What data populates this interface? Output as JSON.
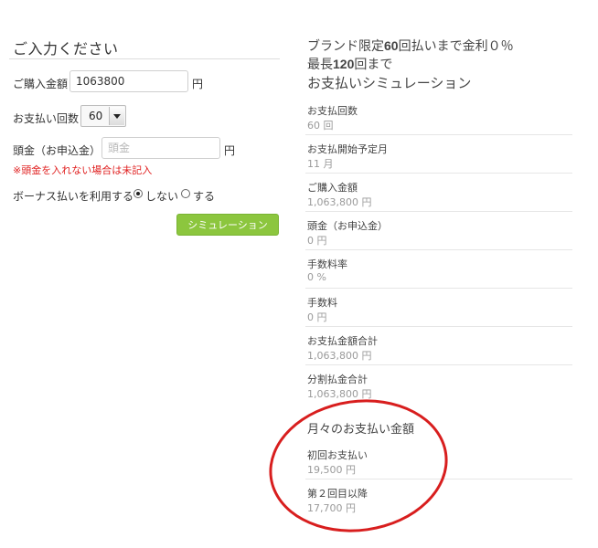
{
  "form": {
    "title": "ご入力ください",
    "purchase_label": "ご購入金額",
    "purchase_value": "1063800",
    "purchase_unit": "円",
    "installments_label": "お支払い回数",
    "installments_value": "60",
    "deposit_label": "頭金（お申込金）",
    "deposit_placeholder": "頭金",
    "deposit_unit": "円",
    "deposit_note": "※頭金を入れない場合は未記入",
    "bonus_label": "ボーナス払いを利用する",
    "bonus_no": "しない",
    "bonus_yes": "する",
    "bonus_selected": "しない",
    "simulate_button": "シミュレーション"
  },
  "result": {
    "heading_line1_pre": "ブランド限定",
    "heading_line1_num": "60",
    "heading_line1_post": "回払いまで金利０％",
    "heading_line2_pre": "最長",
    "heading_line2_num": "120",
    "heading_line2_post": "回まで",
    "heading_line3": "お支払いシミュレーション",
    "rows": [
      {
        "label": "お支払回数",
        "value": "60 回"
      },
      {
        "label": "お支払開始予定月",
        "value": "11 月"
      },
      {
        "label": "ご購入金額",
        "value": "1,063,800 円"
      },
      {
        "label": "頭金（お申込金）",
        "value": "0 円"
      },
      {
        "label": "手数料率",
        "value": "0 %"
      },
      {
        "label": "手数料",
        "value": "0 円"
      },
      {
        "label": "お支払金額合計",
        "value": "1,063,800 円"
      },
      {
        "label": "分割払金合計",
        "value": "1,063,800 円"
      }
    ],
    "monthly_title": "月々のお支払い金額",
    "monthly_rows": [
      {
        "label": "初回お支払い",
        "value": "19,500 円"
      },
      {
        "label": "第２回目以降",
        "value": "17,700 円"
      }
    ]
  },
  "colors": {
    "button_green": "#8cc63e",
    "note_red": "#e02020",
    "highlight_ellipse": "#d81e1e"
  }
}
